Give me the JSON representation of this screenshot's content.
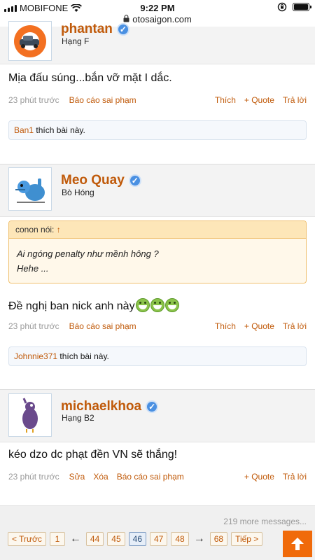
{
  "status_bar": {
    "carrier": "MOBIFONE",
    "time": "9:22 PM"
  },
  "url_bar": {
    "domain": "otosaigon.com"
  },
  "colors": {
    "accent": "#c05a0a",
    "verified": "#4a90e2",
    "scroll_top": "#f06a0a"
  },
  "posts": [
    {
      "username": "phantan",
      "rank": "Hạng F",
      "message": "Mịa đấu súng...bắn vỡ mặt I dắc.",
      "time": "23 phút trước",
      "report": "Báo cáo sai phạm",
      "like": "Thích",
      "quote": "+ Quote",
      "reply": "Trả lời",
      "liker": "Ban1",
      "likes_text": "thích bài này."
    },
    {
      "username": "Meo Quay",
      "rank": "Bò Hóng",
      "quote_author": "conon nói:",
      "quote_arrow": "↑",
      "quote_lines": [
        "Ai ngóng penalty như mềnh hông ?",
        "Hehe ..."
      ],
      "message": "Đề nghị ban nick anh này",
      "time": "23 phút trước",
      "report": "Báo cáo sai phạm",
      "like": "Thích",
      "quote": "+ Quote",
      "reply": "Trả lời",
      "liker": "Johnnie371",
      "likes_text": "thích bài này."
    },
    {
      "username": "michaelkhoa",
      "rank": "Hạng B2",
      "message": "kéo dzo dc phạt đền VN sẽ thắng!",
      "time": "23 phút trước",
      "edit": "Sửa",
      "delete": "Xóa",
      "report": "Báo cáo sai phạm",
      "quote": "+ Quote",
      "reply": "Trả lời"
    }
  ],
  "footer": {
    "more_messages": "219 more messages...",
    "pagination": {
      "prev": "< Trước",
      "first": "1",
      "left_arrow": "←",
      "pages": [
        "44",
        "45",
        "46",
        "47",
        "48"
      ],
      "current": "46",
      "right_arrow": "→",
      "last": "68",
      "next": "Tiếp >"
    }
  }
}
